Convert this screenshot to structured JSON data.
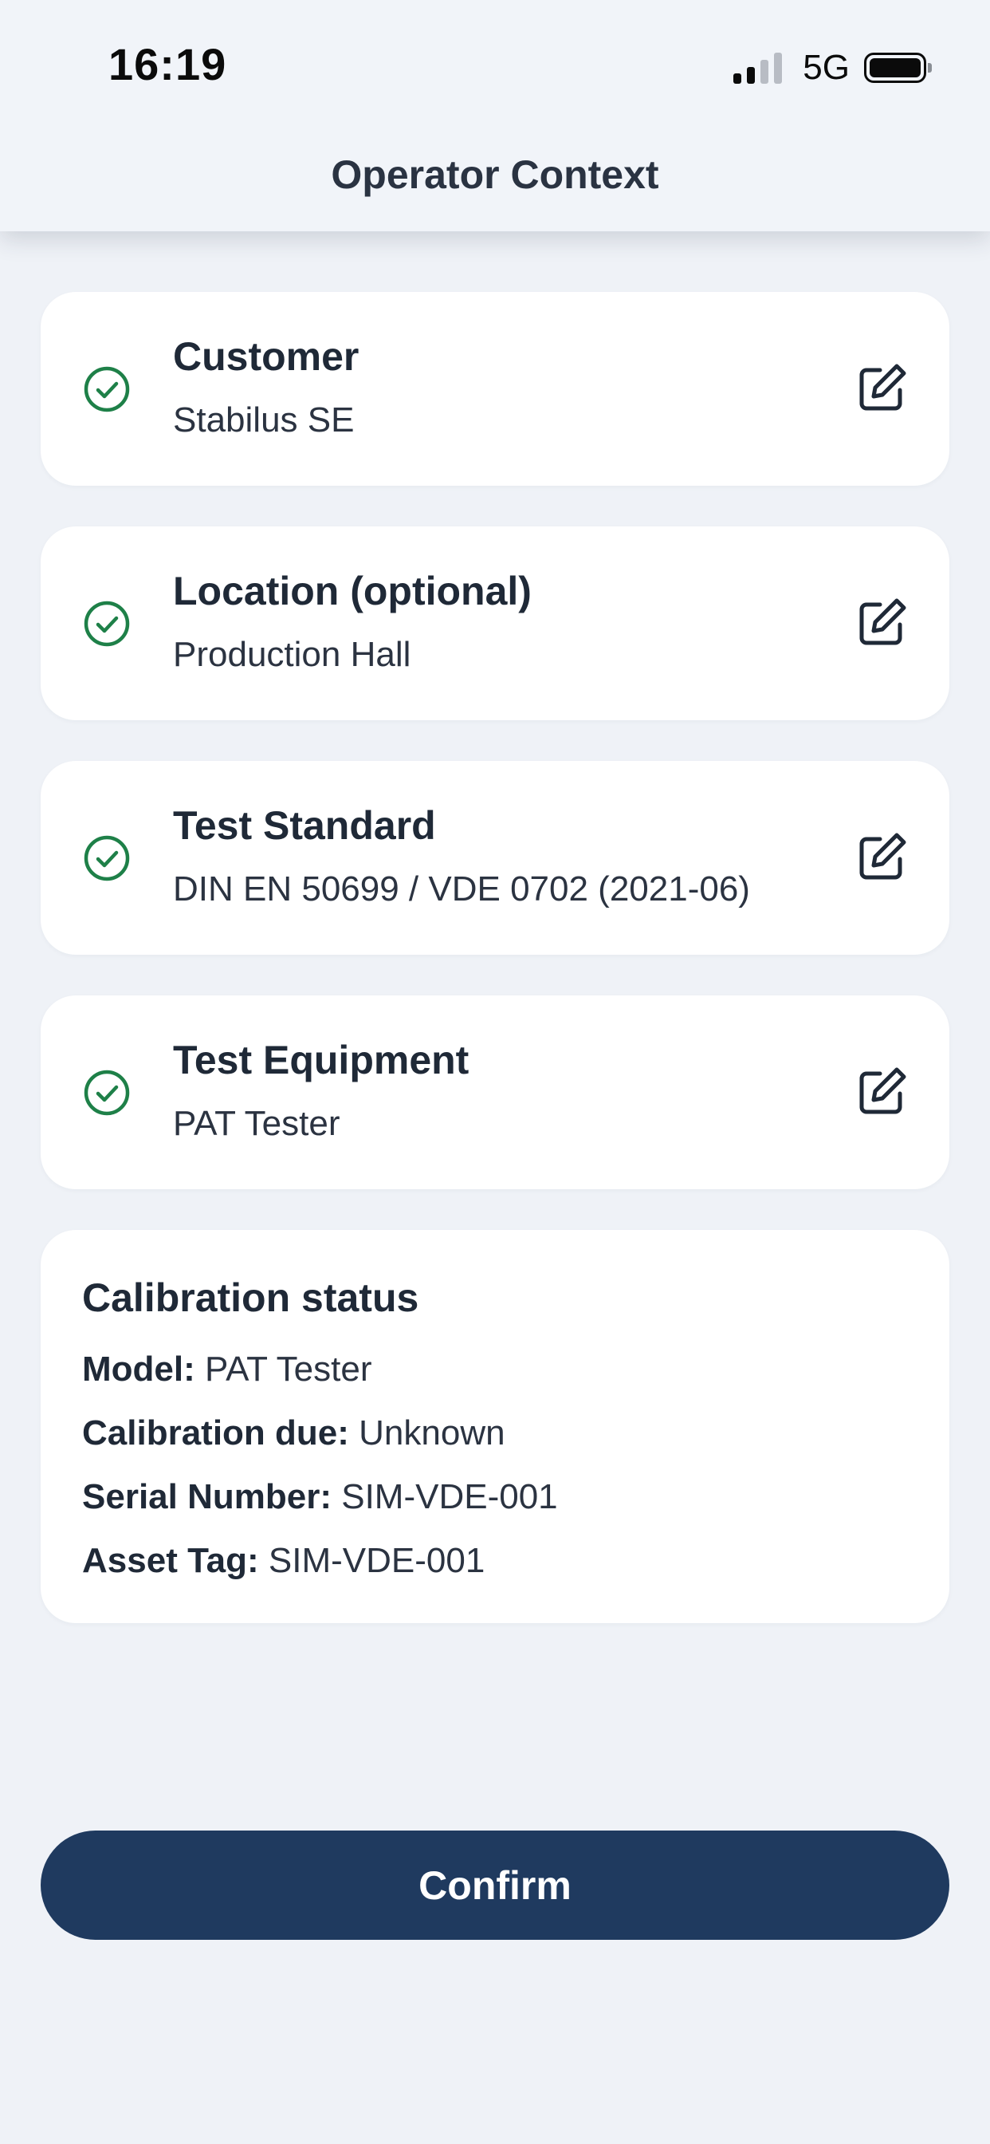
{
  "status_bar": {
    "time": "16:19",
    "network": "5G",
    "signal_bars_active": 2,
    "signal_bars_total": 4
  },
  "header": {
    "title": "Operator Context"
  },
  "context_items": [
    {
      "label": "Customer",
      "value": "Stabilus SE",
      "status": "check-circle-icon",
      "action_icon": "edit-icon"
    },
    {
      "label": "Location (optional)",
      "value": "Production Hall",
      "status": "check-circle-icon",
      "action_icon": "edit-icon"
    },
    {
      "label": "Test Standard",
      "value": "DIN EN 50699 / VDE 0702 (2021-06)",
      "status": "check-circle-icon",
      "action_icon": "edit-icon"
    },
    {
      "label": "Test Equipment",
      "value": "PAT Tester",
      "status": "check-circle-icon",
      "action_icon": "edit-icon"
    }
  ],
  "calibration": {
    "title": "Calibration status",
    "rows": [
      {
        "label": "Model:",
        "value": "PAT Tester"
      },
      {
        "label": "Calibration due:",
        "value": "Unknown"
      },
      {
        "label": "Serial Number:",
        "value": "SIM-VDE-001"
      },
      {
        "label": "Asset Tag:",
        "value": "SIM-VDE-001"
      }
    ]
  },
  "confirm_label": "Confirm",
  "colors": {
    "background": "#eff2f7",
    "card": "#ffffff",
    "check_green": "#1e8048",
    "primary_button": "#1f3a5f",
    "text_primary": "#1f2937"
  }
}
